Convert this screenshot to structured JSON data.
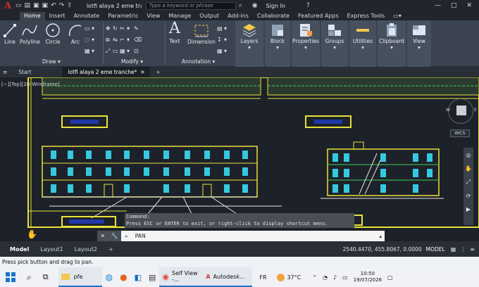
{
  "titlebar": {
    "doc_title": "lotfi alaya  2 eme tra...",
    "search_placeholder": "Type a keyword or phrase",
    "signin": "Sign In",
    "win_min": "—",
    "win_max": "▢",
    "win_close": "✕"
  },
  "menu_tabs": [
    "Home",
    "Insert",
    "Annotate",
    "Parametric",
    "View",
    "Manage",
    "Output",
    "Add-ins",
    "Collaborate",
    "Featured Apps",
    "Express Tools"
  ],
  "ribbon": {
    "draw_tools": [
      "Line",
      "Polyline",
      "Circle",
      "Arc"
    ],
    "annotation_tools": [
      "Text",
      "Dimension"
    ],
    "big_tools": [
      "Layers",
      "Block",
      "Properties",
      "Groups",
      "Utilities",
      "Clipboard",
      "View"
    ],
    "panels": {
      "draw": "Draw ▾",
      "modify": "Modify ▾",
      "annotation": "Annotation ▾"
    }
  },
  "doc_tabs": {
    "start": "Start",
    "active": "lotfi alaya  2 eme tranche*",
    "close": "✕",
    "add": "+"
  },
  "viewport": {
    "label": "[−][Top][2D Wireframe]",
    "wcs": "WCS",
    "compass_w": "W",
    "compass_e": "E"
  },
  "command": {
    "history_title": "Command:",
    "history_line": "Press ESC or ENTER to exit, or right-click to display shortcut menu.",
    "input": "PAN"
  },
  "layout_tabs": [
    "Model",
    "Layout1",
    "Layout2"
  ],
  "status": {
    "coords": "2540.4470, 455.8067, 0.0000",
    "model": "MODEL"
  },
  "prompt": "Press pick button and drag to pan.",
  "taskbar": {
    "items": [
      "pfe",
      "Self View -...",
      "Autodesk..."
    ],
    "lang": "FR",
    "temp": "37°C",
    "time": "10:50",
    "date": "19/07/2026"
  }
}
